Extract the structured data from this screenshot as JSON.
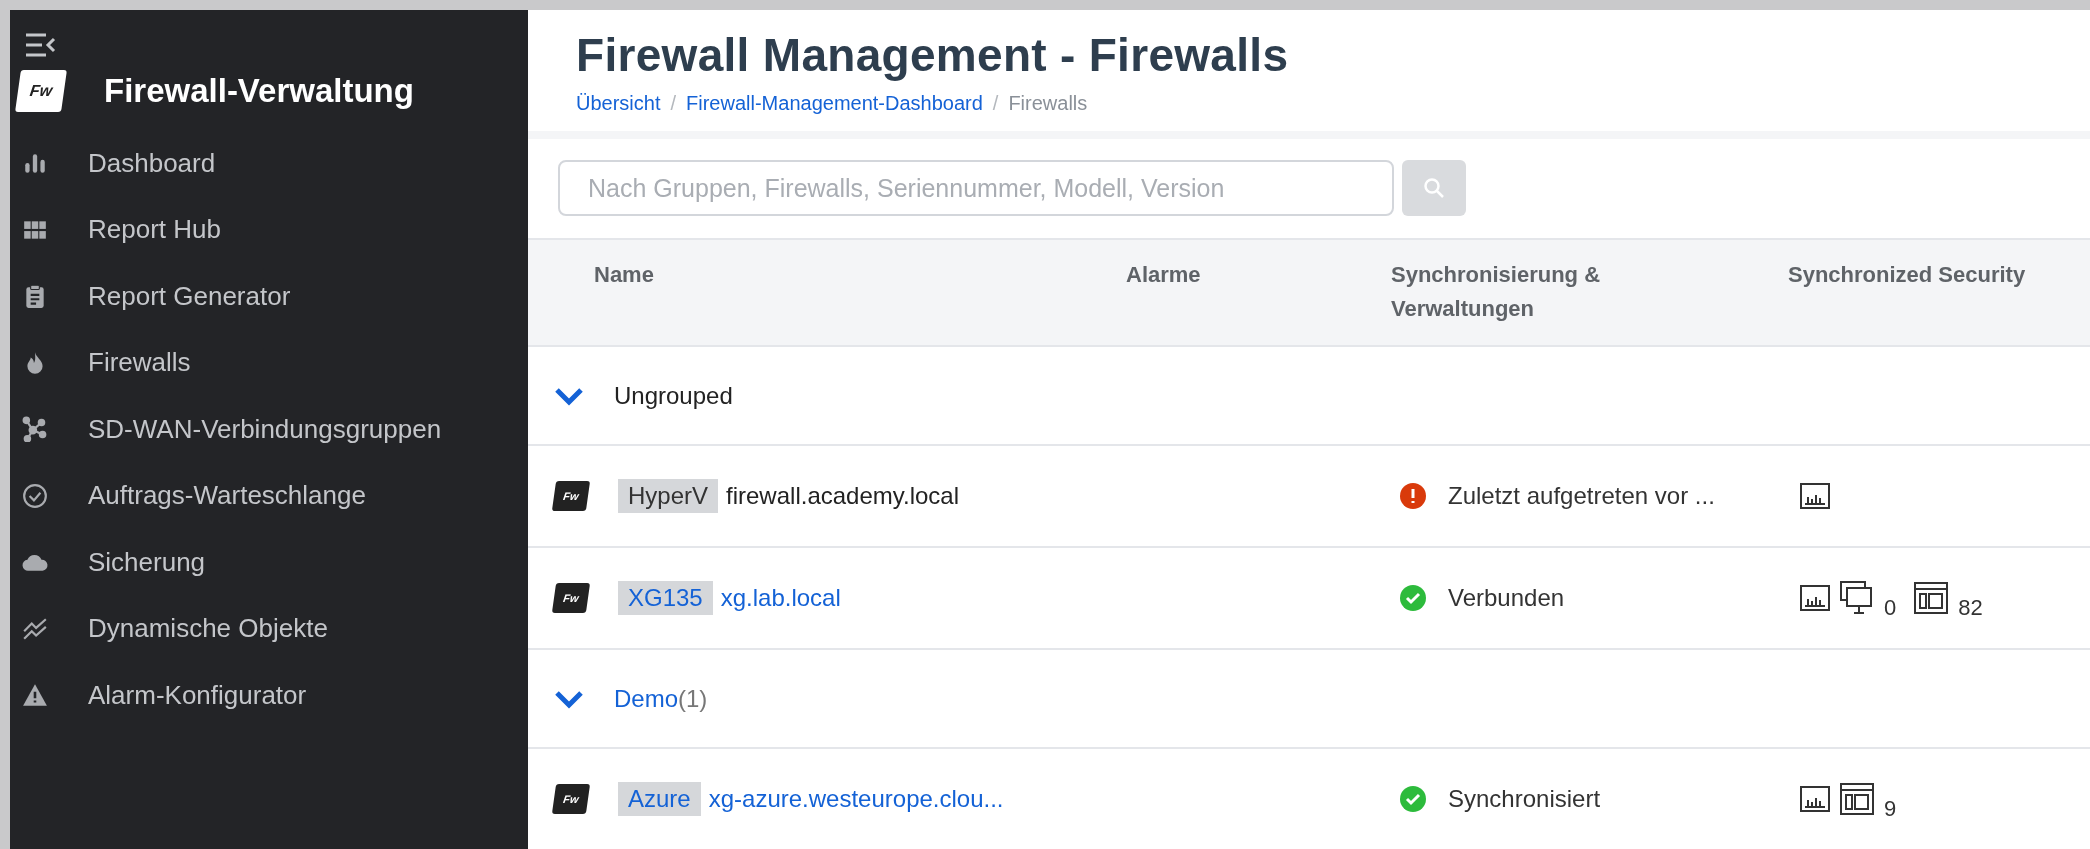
{
  "sidebar": {
    "brand_logo": "Fw",
    "brand": "Firewall-Verwaltung",
    "items": [
      {
        "label": "Dashboard"
      },
      {
        "label": "Report Hub"
      },
      {
        "label": "Report Generator"
      },
      {
        "label": "Firewalls"
      },
      {
        "label": "SD-WAN-Verbindungsgruppen"
      },
      {
        "label": "Auftrags-Warteschlange"
      },
      {
        "label": "Sicherung"
      },
      {
        "label": "Dynamische Objekte"
      },
      {
        "label": "Alarm-Konfigurator"
      }
    ]
  },
  "page": {
    "title": "Firewall Management - Firewalls",
    "separator": "/",
    "breadcrumbs": [
      {
        "label": "Übersicht",
        "link": true
      },
      {
        "label": "Firewall-Management-Dashboard",
        "link": true
      },
      {
        "label": "Firewalls",
        "link": false
      }
    ]
  },
  "search": {
    "placeholder": "Nach Gruppen, Firewalls, Seriennummer, Modell, Version"
  },
  "table": {
    "columns": [
      "Name",
      "Alarme",
      "Synchronisierung & Verwaltungen",
      "Synchronized Security"
    ],
    "groups": [
      {
        "name": "Ungrouped",
        "linked": false,
        "expanded": true,
        "firewalls": [
          {
            "logo": "Fw",
            "model": "HyperV",
            "hostname": "firewall.academy.local",
            "linked": false,
            "status": {
              "kind": "error",
              "text": "Zuletzt aufgetreten vor ..."
            },
            "security": [
              {
                "kind": "chart"
              }
            ]
          },
          {
            "logo": "Fw",
            "model": "XG135",
            "hostname": "xg.lab.local",
            "linked": true,
            "status": {
              "kind": "ok",
              "text": "Verbunden"
            },
            "security": [
              {
                "kind": "chart"
              },
              {
                "kind": "monitor",
                "count": "0"
              },
              {
                "kind": "window",
                "count": "82"
              }
            ]
          }
        ]
      },
      {
        "name": "Demo",
        "count": "(1)",
        "linked": true,
        "expanded": true,
        "firewalls": [
          {
            "logo": "Fw",
            "model": "Azure",
            "hostname": "xg-azure.westeurope.clou...",
            "linked": true,
            "status": {
              "kind": "ok",
              "text": "Synchronisiert"
            },
            "security": [
              {
                "kind": "chart"
              },
              {
                "kind": "window",
                "count": "9"
              }
            ]
          }
        ]
      }
    ]
  }
}
